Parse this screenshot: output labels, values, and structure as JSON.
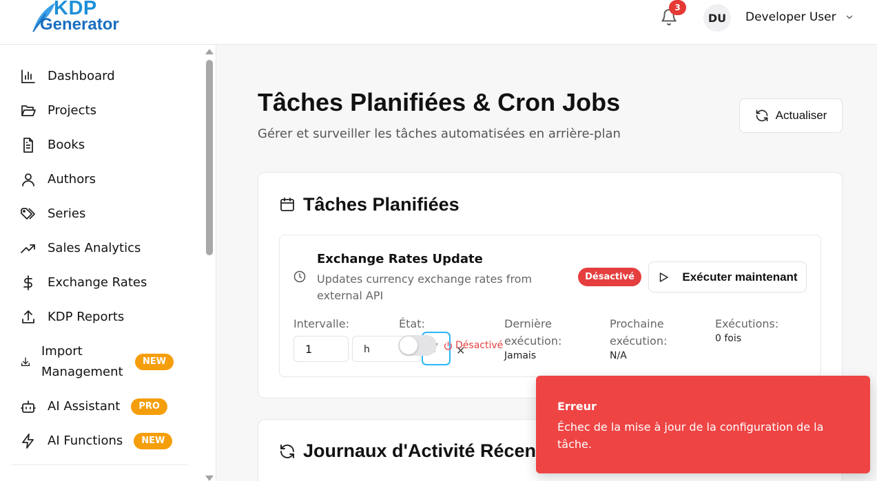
{
  "header": {
    "logo_top": "KDP",
    "logo_bottom": "Generator",
    "notification_count": "3",
    "avatar_initials": "DU",
    "username": "Developer User"
  },
  "sidebar": {
    "items": [
      {
        "label": "Dashboard",
        "icon": "bar-chart-icon"
      },
      {
        "label": "Projects",
        "icon": "folder-open-icon"
      },
      {
        "label": "Books",
        "icon": "file-text-icon"
      },
      {
        "label": "Authors",
        "icon": "user-icon"
      },
      {
        "label": "Series",
        "icon": "tags-icon"
      },
      {
        "label": "Sales Analytics",
        "icon": "trending-up-icon"
      },
      {
        "label": "Exchange Rates",
        "icon": "dollar-icon"
      },
      {
        "label": "KDP Reports",
        "icon": "upload-icon"
      },
      {
        "label": "Import Management",
        "icon": "download-icon",
        "badge": "NEW"
      },
      {
        "label": "AI Assistant",
        "icon": "bot-icon",
        "badge": "PRO"
      },
      {
        "label": "AI Functions",
        "icon": "zap-icon",
        "badge": "NEW"
      }
    ]
  },
  "main": {
    "title": "Tâches Planifiées & Cron Jobs",
    "subtitle": "Gérer et surveiller les tâches automatisées en arrière-plan",
    "refresh_label": "Actualiser",
    "scheduled_card": {
      "title": "Tâches Planifiées",
      "task": {
        "name": "Exchange Rates Update",
        "description": "Updates currency exchange rates from external API",
        "status": "Désactivé",
        "run_label": "Exécuter maintenant",
        "interval_label": "Intervalle:",
        "interval_value": "1",
        "interval_unit": "h",
        "state_label": "État:",
        "state_value": "Désactivé",
        "last_run_label": "Dernière exécution:",
        "last_run_value": "Jamais",
        "next_run_label": "Prochaine exécution:",
        "next_run_value": "N/A",
        "runs_label": "Exécutions:",
        "runs_value": "0 fois"
      }
    },
    "logs_card": {
      "title": "Journaux d'Activité Récente"
    }
  },
  "toast": {
    "title": "Erreur",
    "message": "Échec de la mise à jour de la configuration de la tâche."
  },
  "colors": {
    "danger": "#ef4444",
    "badge_orange": "#f59e0b",
    "focus_ring": "#29b6f6",
    "logo_blue": "#1d8fd8"
  }
}
